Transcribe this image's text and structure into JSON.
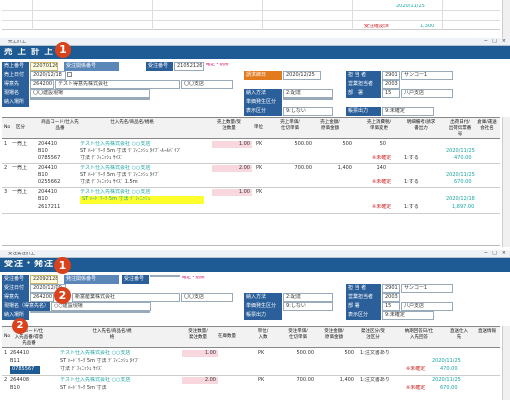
{
  "top": {
    "row_text": "2020/11/25",
    "side_red": "受注確認済",
    "side_teal": "1,300"
  },
  "screen1": {
    "window_title": "売上計上",
    "title": "売 上 計 上",
    "label_uriage_no": "売上番号",
    "value_uriage_no": "22070126",
    "field_juchu_label": "受注関係番号",
    "label_juchu_no": "受注番号",
    "value_juchu_no": "21052126",
    "status_badge": "確定・削除",
    "label_uriage_date": "売上日付",
    "value_uriage_date": "2020/12/18",
    "label_tokui": "得意先",
    "value_tokui_code": "264200",
    "value_tokui_name": "テスト得意先株式会社",
    "value_branch": "〇〇支店",
    "label_genba": "現場名",
    "value_genba": "〇〇建設現場",
    "label_nyuryoku": "納入場所",
    "label_seikyu": "請求締日",
    "value_seikyu": "2020/12/25",
    "label_tanto": "担 当 者",
    "value_tanto_code": "2901",
    "value_tanto_name": "サンコー1",
    "label_eigyo": "営業担当者",
    "value_eigyo": "2003",
    "label_noushi": "納入方法",
    "value_noushi": "2:配達",
    "label_shiten": "部　署",
    "value_shiten_code": "15",
    "value_shiten_name": "八戸支店",
    "label_tanka": "単価発生区分",
    "label_hyoji": "表示区分",
    "value_hyoji": "9:しない",
    "label_hakko": "帳票出力",
    "value_hakko": "9:未確定",
    "headers": [
      "No",
      "区分",
      "商品コード/仕入先品番",
      "仕入先名/商品名/規格",
      "売上数量/受注数量",
      "単位",
      "売上単価/仕切単価",
      "売上金額/原価金額",
      "売上消費税/単価変更",
      "明細備考/請求書出力",
      "出荷日付/出荷伝票番号",
      "倉庫/運送会社名"
    ],
    "rows": [
      {
        "no": "1",
        "kubun": "一売上",
        "code1": "204410",
        "code2": "B10",
        "code3": "0785567",
        "maker": "テスト仕入先株式会社 ○○支店",
        "name": "ST ﾊｰﾄﾞﾜｰｸ 5m 寸法 ﾃﾞﾌｨﾆｯｼｭ ﾀｲﾌﾟ-ﾙｰﾙﾊﾟｲﾌﾟ",
        "spec": "寸法 ﾃﾞﾌｨﾆｯｼｭ ｻｲｽﾞ",
        "qty": "1.00",
        "unit": "PK",
        "price": "500.00",
        "amount": "500",
        "tax": "50",
        "note_red": "※未確定",
        "note": "1:する",
        "date": "2020/11/25",
        "extra": "470.00"
      },
      {
        "no": "2",
        "kubun": "一売上",
        "code1": "204410",
        "code2": "B10",
        "code3": "0255662",
        "maker": "テスト仕入先株式会社 ○○支店",
        "name": "ST ﾊｰﾄﾞﾜｰｸ 5m 寸法 ﾃﾞﾌｨﾆｯｼｭ ﾀｲﾌﾟ",
        "spec": "寸法 ﾃﾞﾌｨﾆｯｼｭ ｻｲｽﾞ 1.5m",
        "qty": "2.00",
        "unit": "PK",
        "price": "700.00",
        "amount": "1,400",
        "tax": "140",
        "note_red": "※未確定",
        "note": "1:する",
        "date": "2020/11/25",
        "extra": "670.00"
      },
      {
        "no": "3",
        "kubun": "一売上",
        "code1": "204410",
        "code2": "B10",
        "code3": "2617211",
        "maker": "テスト仕入先株式会社 ○○支店",
        "name": "ST ﾊｰﾄﾞﾜｰｸ 5m 寸法 ﾃﾞﾌｨﾆｯｼｭ",
        "spec": "",
        "qty": "1.00",
        "unit": "PK",
        "price": "",
        "amount": "",
        "tax": "",
        "note_red": "※未確定",
        "note": "1:する",
        "date": "2020/12/18",
        "extra": "1,897.00"
      }
    ]
  },
  "screen2": {
    "window_title": "受注発注計上",
    "title": "受注・発注",
    "label_juchu_no": "受注番号",
    "value_juchu_no": "22092128",
    "field_rel": "発注関係番号",
    "label_hatchu": "受注番号",
    "status_badge": "確定・削除",
    "label_juchu_date": "受注日付",
    "value_juchu_date": "2020/12/09",
    "label_tokui": "得意先",
    "value_tokui_code": "264200",
    "value_tokui_name": "新富産業株式会社",
    "value_branch": "〇〇支店",
    "label_genba": "現場名（得意先名）",
    "value_genba": "○○建設現場",
    "label_nyuryoku": "納入場所",
    "label_tanto": "担 当 者",
    "value_tanto_code": "2901",
    "value_tanto_name": "サンコー1",
    "label_eigyo": "営業担当者",
    "value_eigyo": "2003",
    "label_noushi": "納入方法",
    "value_noushi": "2:配達",
    "label_shiten": "部 署",
    "value_shiten_code": "15",
    "value_shiten_name": "八戸支店",
    "label_tanka": "単価発生区分",
    "value_tanka": "9:しない",
    "label_hyoji": "表示区分",
    "value_hyoji": "9:未確定",
    "label_hakko": "帳票出力",
    "headers": [
      "No",
      "商品コード/仕入先品番/得意先品番",
      "仕入先名/商品名/規格",
      "受注数量/発注数量",
      "在庫数量",
      "単位/入数",
      "受注単価/仕切単価",
      "受注金額/原価金額",
      "発注区分/受注区分",
      "納期回答日/仕入先回答",
      "直送仕入先",
      "直送情報"
    ],
    "rows": [
      {
        "no": "1",
        "code1": "264410",
        "code2": "B11",
        "code3": "0785567",
        "maker": "テスト仕入先株式会社 ○○支店",
        "name": "ST ﾊｰﾄﾞﾜｰｸ 5m 寸法 ﾃﾞﾌｨﾆｯｼｭ ﾀｲﾌﾟ",
        "spec": "寸法 ﾃﾞﾌｨﾆｯｼｭ ｻｲｽﾞ",
        "qty": "1.00",
        "unit": "PK",
        "price": "500.00",
        "amount": "500",
        "kubun": "1:注文書あり",
        "red": "※未確定",
        "date": "2020/11/25",
        "extra": "470.00"
      },
      {
        "no": "2",
        "code1": "264408",
        "code2": "B10",
        "code3": "",
        "maker": "テスト仕入先株式会社 ○○支店",
        "name": "ST ﾊｰﾄﾞﾜｰｸ 5m 寸法",
        "spec": "",
        "qty": "2.00",
        "unit": "PK",
        "price": "700.00",
        "amount": "1,400",
        "kubun": "1:注文書あり",
        "red": "※未確定",
        "date": "2020/11/25",
        "extra": "670.00"
      }
    ]
  },
  "markers": [
    "1",
    "2"
  ]
}
